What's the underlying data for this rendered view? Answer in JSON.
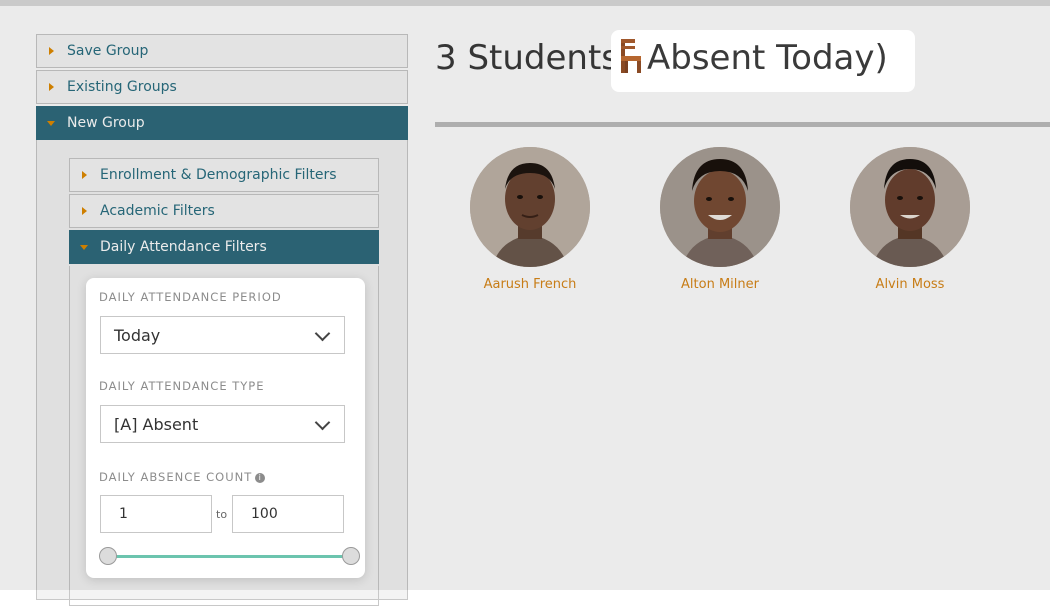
{
  "sidebar": {
    "items": [
      {
        "label": "Save Group",
        "open": false
      },
      {
        "label": "Existing Groups",
        "open": false
      },
      {
        "label": "New Group",
        "open": true
      }
    ],
    "new_group_sections": [
      {
        "label": "Enrollment & Demographic Filters",
        "open": false
      },
      {
        "label": "Academic Filters",
        "open": false
      },
      {
        "label": "Daily Attendance Filters",
        "open": true
      }
    ]
  },
  "filters": {
    "period_label": "DAILY ATTENDANCE PERIOD",
    "period_value": "Today",
    "type_label": "DAILY ATTENDANCE TYPE",
    "type_value": "[A] Absent",
    "count_label": "DAILY ABSENCE COUNT",
    "count_min": "1",
    "to_label": "to",
    "count_max": "100"
  },
  "main": {
    "count_title": "3 Students (",
    "highlight_text": "Absent Today)",
    "students": [
      {
        "name": "Aarush French"
      },
      {
        "name": "Alton Milner"
      },
      {
        "name": "Alvin Moss"
      }
    ]
  },
  "colors": {
    "accent": "#2f6b7d",
    "orange": "#e08a00",
    "slider": "#6cc4ae",
    "name": "#d9881a"
  }
}
